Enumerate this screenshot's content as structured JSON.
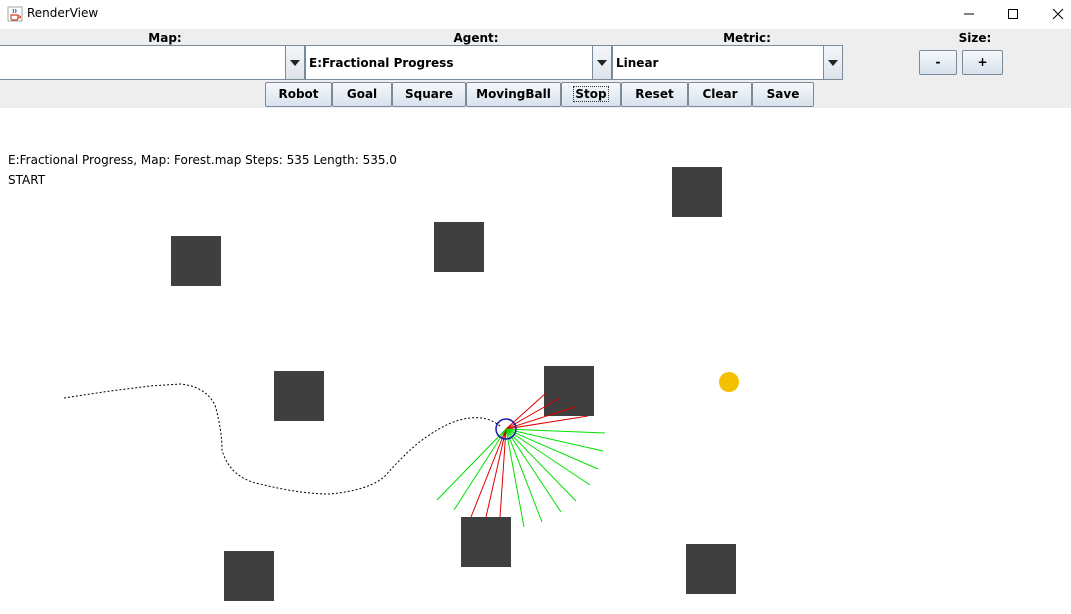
{
  "window": {
    "title": "RenderView",
    "icon": "java-cup-icon",
    "controls": [
      "minimize-icon",
      "maximize-icon",
      "close-icon"
    ]
  },
  "panel": {
    "map_label": "Map:",
    "agent_label": "Agent:",
    "metric_label": "Metric:",
    "size_label": "Size:",
    "map_value": "",
    "agent_value": "E:Fractional Progress",
    "metric_value": "Linear",
    "size_minus": "-",
    "size_plus": "+",
    "buttons": {
      "robot": "Robot",
      "goal": "Goal",
      "square": "Square",
      "movingball": "MovingBall",
      "stop": "Stop",
      "reset": "Reset",
      "clear": "Clear",
      "save": "Save"
    }
  },
  "simulation": {
    "status": "E:Fractional Progress, Map: Forest.map Steps: 535 Length: 535.0",
    "state": "START",
    "obstacle_color": "#3f3f3f",
    "goal_color": "#f5c000",
    "robot_color": "#1a1aa8",
    "sensor_hit_color": "#e00000",
    "sensor_clear_color": "#00e000",
    "path_color": "#000000"
  }
}
